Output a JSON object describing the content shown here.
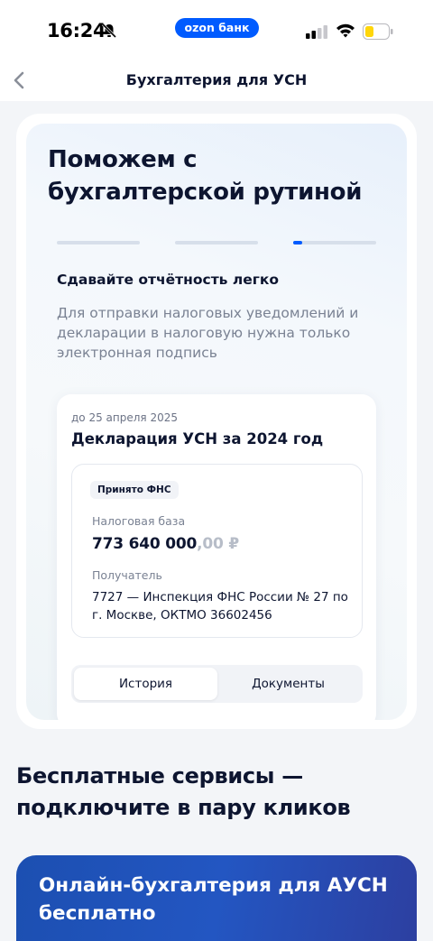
{
  "status_bar": {
    "time": "16:24",
    "brand": "ozon банк",
    "icons": [
      "bell-slash-icon",
      "signal-icon",
      "wifi-icon",
      "battery-icon"
    ]
  },
  "header": {
    "title": "Бухгалтерия для УСН",
    "back_icon": "chevron-left-icon"
  },
  "promo": {
    "title": "Поможем с бухгалтерской рутиной",
    "slides_total": 3,
    "active_slide": 3,
    "slide_heading": "Сдавайте отчётность легко",
    "slide_text": "Для отправки налоговых уведомлений и декларации в налоговую нужна только электронная подпись",
    "mock": {
      "due_date": "до 25 апреля 2025",
      "declaration_title": "Декларация УСН за 2024 год",
      "status_badge": "Принято ФНС",
      "tax_base_label": "Налоговая база",
      "tax_base_main": "773 640 000",
      "tax_base_fraction": ",00 ₽",
      "recipient_label": "Получатель",
      "recipient_value": "7727 — Инспекция ФНС России № 27 по г. Москве, ОКТМО 36602456",
      "tabs": [
        {
          "label": "История",
          "active": true
        },
        {
          "label": "Документы",
          "active": false
        }
      ]
    }
  },
  "free_services": {
    "title": "Бесплатные сервисы — подключите в пару кликов",
    "card_title": "Онлайн-бухгалтерия для АУСН бесплатно"
  },
  "colors": {
    "accent": "#005bff",
    "text_primary": "#0d1530",
    "text_secondary": "#7a8293",
    "card_blue": "#2356c2"
  }
}
